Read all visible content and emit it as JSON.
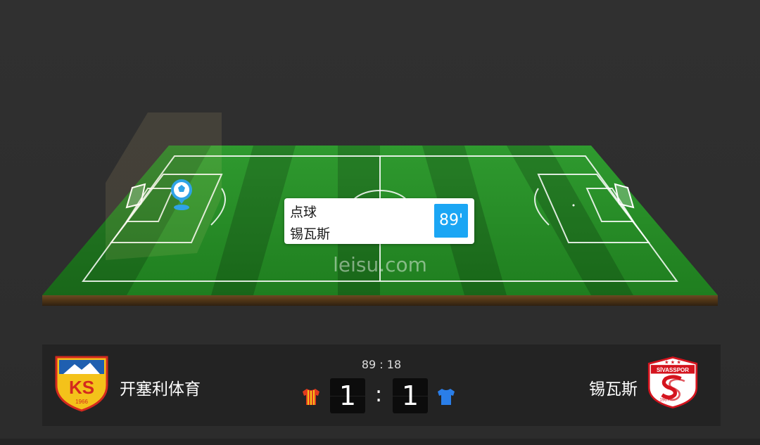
{
  "event": {
    "type": "点球",
    "team": "锡瓦斯",
    "minute": "89'"
  },
  "watermark": "leisu.com",
  "match": {
    "clock": "89 : 18",
    "separator": ":",
    "home": {
      "name": "开塞利体育",
      "score": "1",
      "crest_letters": "KS",
      "crest_year": "1966",
      "jersey_colors": [
        "#e23b1e",
        "#f4c21a"
      ]
    },
    "away": {
      "name": "锡瓦斯",
      "score": "1",
      "crest_text": "SİVASSPOR",
      "crest_year": "1967",
      "jersey_color": "#2a7ee8"
    }
  },
  "colors": {
    "pitch_light": "#3aa53a",
    "pitch_dark": "#2f942f",
    "minute_badge": "#1ba6f4",
    "scorebar_bg": "#232323"
  }
}
